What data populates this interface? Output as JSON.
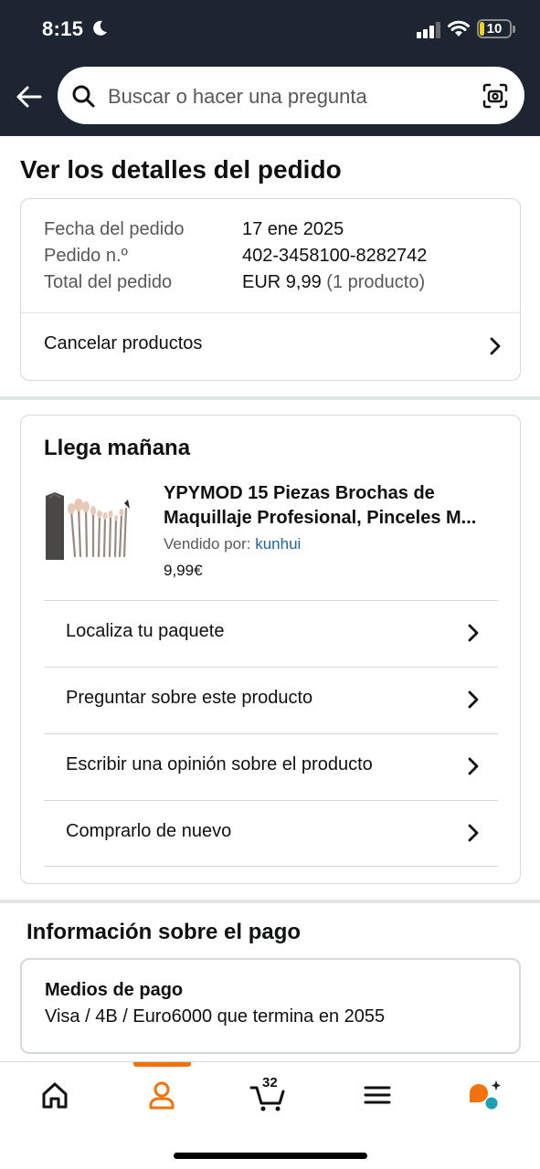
{
  "status_bar": {
    "time": "8:15",
    "battery": "10"
  },
  "header": {
    "search_placeholder": "Buscar o hacer una pregunta"
  },
  "page_title": "Ver los detalles del pedido",
  "order_summary": {
    "date_label": "Fecha del pedido",
    "date_value": "17 ene 2025",
    "number_label": "Pedido n.º",
    "number_value": "402-3458100-8282742",
    "total_label": "Total del pedido",
    "total_value": "EUR 9,99",
    "total_count": "(1 producto)",
    "cancel_label": "Cancelar productos"
  },
  "shipment": {
    "heading": "Llega mañana",
    "product_title_line1": "YPYMOD 15 Piezas Brochas de",
    "product_title_line2": "Maquillaje Profesional, Pinceles M...",
    "seller_prefix": "Vendido por:",
    "seller_name": "kunhui",
    "price": "9,99€",
    "actions": [
      "Localiza tu paquete",
      "Preguntar sobre este producto",
      "Escribir una opinión sobre el producto",
      "Comprarlo de nuevo"
    ]
  },
  "payment": {
    "title": "Información sobre el pago",
    "methods_label": "Medios de pago",
    "methods_value": "Visa / 4B / Euro6000  que termina en 2055"
  },
  "bottom_nav": {
    "cart_count": "32",
    "active": "account"
  },
  "colors": {
    "header_bg": "#1c2531",
    "accent": "#f2720d",
    "link": "#2162a1"
  }
}
